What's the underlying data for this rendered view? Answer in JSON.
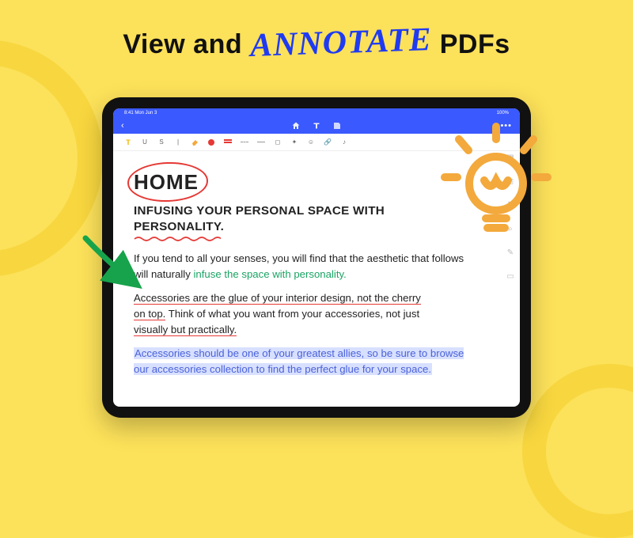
{
  "headline": {
    "pre": "View and ",
    "hand": "ANNOTATE",
    "post": " PDFs"
  },
  "status": {
    "time": "8:41  Mon Jun 3",
    "wifi": "100%"
  },
  "doc": {
    "home": "HOME",
    "subhead_a": "INFUSING YOUR PERSONAL SPACE WITH",
    "subhead_b": "PERSONALITY.",
    "p1a": "If you tend to all your senses, you will find that the aesthetic that follows will naturally ",
    "p1b": "infuse the space with personality.",
    "p2a": "Accessories are the glue of your interior design, not the cherry",
    "p2b": "on top.",
    "p2c": " Think of what you want from your accessories, not just",
    "p2d": "visually but practically.",
    "p3": "Accessories should be one of your greatest allies, so be sure to browse our accessories collection to find the perfect glue for your space."
  },
  "toolbar": {
    "t_glyph": "T",
    "u_glyph": "U",
    "s_glyph": "S"
  }
}
